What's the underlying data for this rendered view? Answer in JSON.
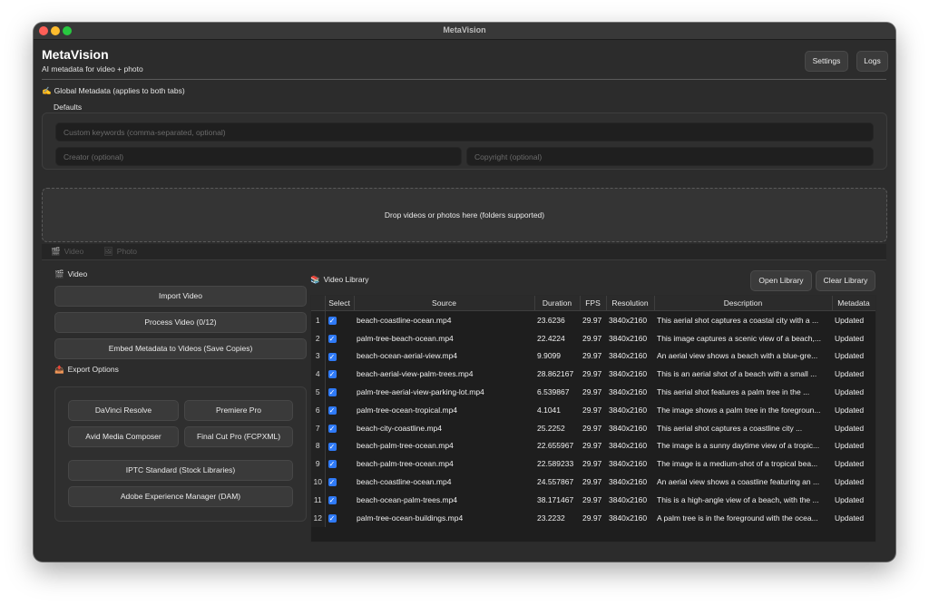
{
  "window": {
    "title": "MetaVision"
  },
  "app": {
    "title": "MetaVision",
    "subtitle": "AI metadata for video + photo"
  },
  "header": {
    "settings_label": "Settings",
    "logs_label": "Logs"
  },
  "global_metadata": {
    "label": "Global Metadata (applies to both tabs)",
    "icon": "pencil-icon"
  },
  "defaults": {
    "label": "Defaults",
    "keywords_placeholder": "Custom keywords (comma-separated, optional)",
    "creator_placeholder": "Creator (optional)",
    "copyright_placeholder": "Copyright (optional)"
  },
  "dropzone": {
    "text": "Drop videos or photos here (folders supported)"
  },
  "tabs": [
    {
      "label": "Video",
      "icon": "clapper-icon"
    },
    {
      "label": "Photo",
      "icon": "image-icon"
    }
  ],
  "video_panel": {
    "label": "Video",
    "import_label": "Import Video",
    "process_label": "Process Video (0/12)",
    "embed_label": "Embed Metadata to Videos (Save Copies)"
  },
  "export": {
    "label": "Export Options",
    "davinci": "DaVinci Resolve",
    "premiere": "Premiere Pro",
    "avid": "Avid Media Composer",
    "fcp": "Final Cut Pro (FCPXML)",
    "iptc": "IPTC Standard (Stock Libraries)",
    "aem": "Adobe Experience Manager (DAM)"
  },
  "library": {
    "label": "Video Library",
    "open_label": "Open Library",
    "clear_label": "Clear Library",
    "columns": [
      "Select",
      "Source",
      "Duration",
      "FPS",
      "Resolution",
      "Description",
      "Metadata"
    ],
    "rows": [
      {
        "n": "1",
        "source": "beach-coastline-ocean.mp4",
        "duration": "23.6236",
        "fps": "29.97",
        "res": "3840x2160",
        "desc": "This aerial shot captures a coastal city with a ...",
        "meta": "Updated"
      },
      {
        "n": "2",
        "source": "palm-tree-beach-ocean.mp4",
        "duration": "22.4224",
        "fps": "29.97",
        "res": "3840x2160",
        "desc": "This image captures a scenic view of a beach,...",
        "meta": "Updated"
      },
      {
        "n": "3",
        "source": "beach-ocean-aerial-view.mp4",
        "duration": "9.9099",
        "fps": "29.97",
        "res": "3840x2160",
        "desc": "An aerial view shows a beach with a blue-gre...",
        "meta": "Updated"
      },
      {
        "n": "4",
        "source": "beach-aerial-view-palm-trees.mp4",
        "duration": "28.862167",
        "fps": "29.97",
        "res": "3840x2160",
        "desc": "This is an aerial shot of a beach with a small ...",
        "meta": "Updated"
      },
      {
        "n": "5",
        "source": "palm-tree-aerial-view-parking-lot.mp4",
        "duration": "6.539867",
        "fps": "29.97",
        "res": "3840x2160",
        "desc": "This aerial shot features a palm tree in the ...",
        "meta": "Updated"
      },
      {
        "n": "6",
        "source": "palm-tree-ocean-tropical.mp4",
        "duration": "4.1041",
        "fps": "29.97",
        "res": "3840x2160",
        "desc": "The image shows a palm tree in the foregroun...",
        "meta": "Updated"
      },
      {
        "n": "7",
        "source": "beach-city-coastline.mp4",
        "duration": "25.2252",
        "fps": "29.97",
        "res": "3840x2160",
        "desc": "This aerial shot captures a coastline city ...",
        "meta": "Updated"
      },
      {
        "n": "8",
        "source": "beach-palm-tree-ocean.mp4",
        "duration": "22.655967",
        "fps": "29.97",
        "res": "3840x2160",
        "desc": "The image is a sunny daytime view of a tropic...",
        "meta": "Updated"
      },
      {
        "n": "9",
        "source": "beach-palm-tree-ocean.mp4",
        "duration": "22.589233",
        "fps": "29.97",
        "res": "3840x2160",
        "desc": "The image is a medium-shot of a tropical bea...",
        "meta": "Updated"
      },
      {
        "n": "10",
        "source": "beach-coastline-ocean.mp4",
        "duration": "24.557867",
        "fps": "29.97",
        "res": "3840x2160",
        "desc": "An aerial view shows a coastline featuring an ...",
        "meta": "Updated"
      },
      {
        "n": "11",
        "source": "beach-ocean-palm-trees.mp4",
        "duration": "38.171467",
        "fps": "29.97",
        "res": "3840x2160",
        "desc": "This is a high-angle view of a beach, with the ...",
        "meta": "Updated"
      },
      {
        "n": "12",
        "source": "palm-tree-ocean-buildings.mp4",
        "duration": "23.2232",
        "fps": "29.97",
        "res": "3840x2160",
        "desc": "A palm tree is in the foreground with the ocea...",
        "meta": "Updated"
      }
    ]
  }
}
